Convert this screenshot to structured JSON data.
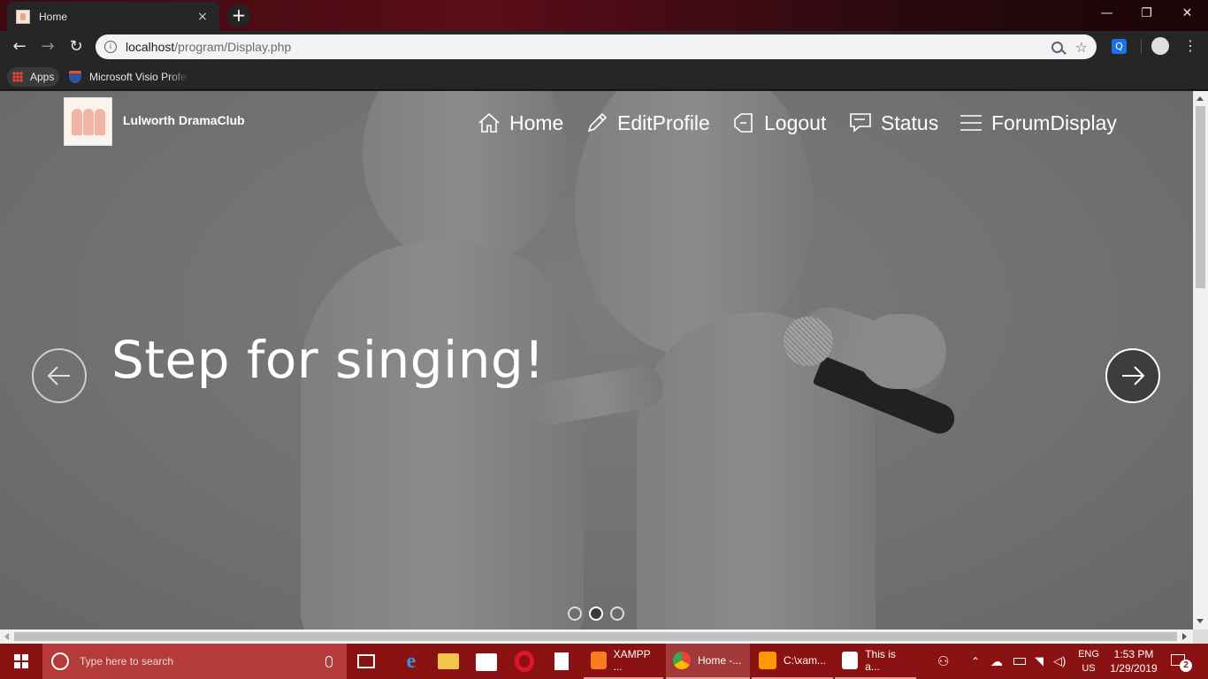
{
  "browser": {
    "tab_title": "Home",
    "tab_close": "×",
    "new_tab": "+",
    "window_controls": {
      "minimize": "—",
      "maximize": "❐",
      "close": "✕"
    },
    "url_host": "localhost",
    "url_path": "/program/Display.php",
    "nav": {
      "back": "←",
      "forward": "→",
      "reload": "↻",
      "info": "i",
      "star": "☆",
      "menu": "⋮",
      "ext": "Q"
    },
    "bookmarks": [
      {
        "label": "Apps",
        "icon": "apps-grid-icon"
      },
      {
        "label": "Microsoft Visio Professional",
        "icon": "visio-icon"
      }
    ]
  },
  "site": {
    "brand": "Lulworth DramaClub",
    "nav": [
      {
        "label": "Home",
        "icon": "home-icon"
      },
      {
        "label": "EditProfile",
        "icon": "pencil-icon"
      },
      {
        "label": "Logout",
        "icon": "logout-icon"
      },
      {
        "label": "Status",
        "icon": "comment-icon"
      },
      {
        "label": "ForumDisplay",
        "icon": "list-icon"
      }
    ],
    "slider": {
      "headline": "Step for singing!",
      "slide_count": 3,
      "active_slide": 2
    }
  },
  "taskbar": {
    "search_placeholder": "Type here to search",
    "apps": [
      {
        "label": "XAMPP ...",
        "active": false
      },
      {
        "label": "Home -...",
        "active": true
      },
      {
        "label": "C:\\xam...",
        "active": false
      },
      {
        "label": "This is a...",
        "active": false
      }
    ],
    "lang_top": "ENG",
    "lang_bottom": "US",
    "time": "1:53 PM",
    "date": "1/29/2019",
    "notification_count": "2"
  },
  "colors": {
    "taskbar": "#8b1212",
    "search_box": "#b53a3a",
    "titlebar": "#5a0d18",
    "toolbar": "#262626"
  }
}
